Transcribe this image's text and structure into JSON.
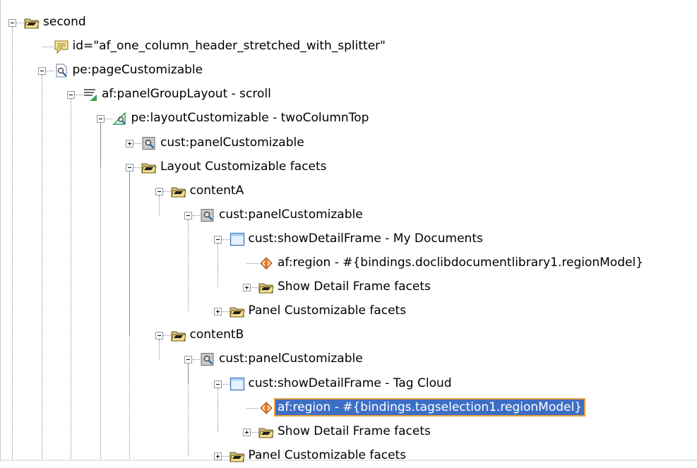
{
  "tree": {
    "nodes": [
      {
        "label": "second",
        "icon": "folder-icon",
        "level": 0,
        "toggle": "minus",
        "selected": false
      },
      {
        "label": "id=\"af_one_column_header_stretched_with_splitter\"",
        "icon": "comment-icon",
        "level": 1,
        "toggle": "none",
        "selected": false
      },
      {
        "label": "pe:pageCustomizable",
        "icon": "customizable-page-icon",
        "level": 1,
        "toggle": "minus",
        "selected": false
      },
      {
        "label": "af:panelGroupLayout - scroll",
        "icon": "panel-group-layout-icon",
        "level": 2,
        "toggle": "minus",
        "selected": false
      },
      {
        "label": "pe:layoutCustomizable - twoColumnTop",
        "icon": "layout-customizable-icon",
        "level": 3,
        "toggle": "minus",
        "selected": false
      },
      {
        "label": "cust:panelCustomizable",
        "icon": "panel-customizable-icon",
        "level": 4,
        "toggle": "plus",
        "selected": false
      },
      {
        "label": "Layout Customizable facets",
        "icon": "folder-icon",
        "level": 4,
        "toggle": "minus",
        "selected": false
      },
      {
        "label": "contentA",
        "icon": "folder-icon",
        "level": 5,
        "toggle": "minus",
        "selected": false
      },
      {
        "label": "cust:panelCustomizable",
        "icon": "panel-customizable-icon",
        "level": 6,
        "toggle": "minus",
        "selected": false
      },
      {
        "label": "cust:showDetailFrame - My Documents",
        "icon": "show-detail-frame-icon",
        "level": 7,
        "toggle": "minus",
        "selected": false
      },
      {
        "label": "af:region - #{bindings.doclibdocumentlibrary1.regionModel}",
        "icon": "region-icon",
        "level": 8,
        "toggle": "none",
        "selected": false
      },
      {
        "label": "Show Detail Frame facets",
        "icon": "folder-icon",
        "level": 8,
        "toggle": "plus",
        "selected": false
      },
      {
        "label": "Panel Customizable facets",
        "icon": "folder-icon",
        "level": 7,
        "toggle": "plus",
        "selected": false
      },
      {
        "label": "contentB",
        "icon": "folder-icon",
        "level": 5,
        "toggle": "minus",
        "selected": false
      },
      {
        "label": "cust:panelCustomizable",
        "icon": "panel-customizable-icon",
        "level": 6,
        "toggle": "minus",
        "selected": false
      },
      {
        "label": "cust:showDetailFrame - Tag Cloud",
        "icon": "show-detail-frame-icon",
        "level": 7,
        "toggle": "minus",
        "selected": false
      },
      {
        "label": "af:region - #{bindings.tagselection1.regionModel}",
        "icon": "region-icon",
        "level": 8,
        "toggle": "none",
        "selected": true
      },
      {
        "label": "Show Detail Frame facets",
        "icon": "folder-icon",
        "level": 8,
        "toggle": "plus",
        "selected": false
      },
      {
        "label": "Panel Customizable facets",
        "icon": "folder-icon",
        "level": 7,
        "toggle": "plus",
        "selected": false
      }
    ]
  }
}
